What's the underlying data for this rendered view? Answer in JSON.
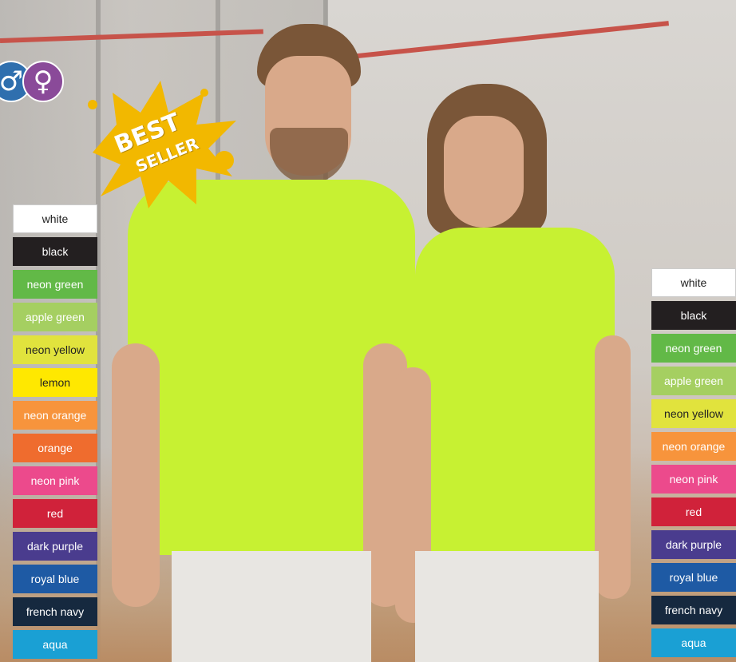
{
  "gender_icons": [
    {
      "name": "male",
      "glyph": "♂",
      "color": "#2f6fae"
    },
    {
      "name": "female",
      "glyph": "♀",
      "color": "#8a4a99"
    }
  ],
  "badge": {
    "line1": "BEST",
    "line2": "SELLER",
    "color": "#f2b800"
  },
  "left_colors": [
    {
      "label": "white",
      "bg": "#ffffff",
      "fg": "#222222"
    },
    {
      "label": "black",
      "bg": "#231f20",
      "fg": "#ffffff"
    },
    {
      "label": "neon green",
      "bg": "#62b947",
      "fg": "#ffffff"
    },
    {
      "label": "apple green",
      "bg": "#a5cf61",
      "fg": "#ffffff"
    },
    {
      "label": "neon yellow",
      "bg": "#e1e33d",
      "fg": "#222222"
    },
    {
      "label": "lemon",
      "bg": "#ffe800",
      "fg": "#222222"
    },
    {
      "label": "neon orange",
      "bg": "#f7943c",
      "fg": "#ffffff"
    },
    {
      "label": "orange",
      "bg": "#ef6c2e",
      "fg": "#ffffff"
    },
    {
      "label": "neon pink",
      "bg": "#ec4a8c",
      "fg": "#ffffff"
    },
    {
      "label": "red",
      "bg": "#d0223a",
      "fg": "#ffffff"
    },
    {
      "label": "dark purple",
      "bg": "#4a3c8e",
      "fg": "#ffffff"
    },
    {
      "label": "royal blue",
      "bg": "#1e5aa4",
      "fg": "#ffffff"
    },
    {
      "label": "french navy",
      "bg": "#16293f",
      "fg": "#ffffff"
    },
    {
      "label": "aqua",
      "bg": "#1aa0d4",
      "fg": "#ffffff"
    }
  ],
  "right_colors": [
    {
      "label": "white",
      "bg": "#ffffff",
      "fg": "#222222"
    },
    {
      "label": "black",
      "bg": "#231f20",
      "fg": "#ffffff"
    },
    {
      "label": "neon green",
      "bg": "#62b947",
      "fg": "#ffffff"
    },
    {
      "label": "apple green",
      "bg": "#a5cf61",
      "fg": "#ffffff"
    },
    {
      "label": "neon yellow",
      "bg": "#e1e33d",
      "fg": "#222222"
    },
    {
      "label": "neon orange",
      "bg": "#f7943c",
      "fg": "#ffffff"
    },
    {
      "label": "neon pink",
      "bg": "#ec4a8c",
      "fg": "#ffffff"
    },
    {
      "label": "red",
      "bg": "#d0223a",
      "fg": "#ffffff"
    },
    {
      "label": "dark purple",
      "bg": "#4a3c8e",
      "fg": "#ffffff"
    },
    {
      "label": "royal blue",
      "bg": "#1e5aa4",
      "fg": "#ffffff"
    },
    {
      "label": "french navy",
      "bg": "#16293f",
      "fg": "#ffffff"
    },
    {
      "label": "aqua",
      "bg": "#1aa0d4",
      "fg": "#ffffff"
    }
  ]
}
